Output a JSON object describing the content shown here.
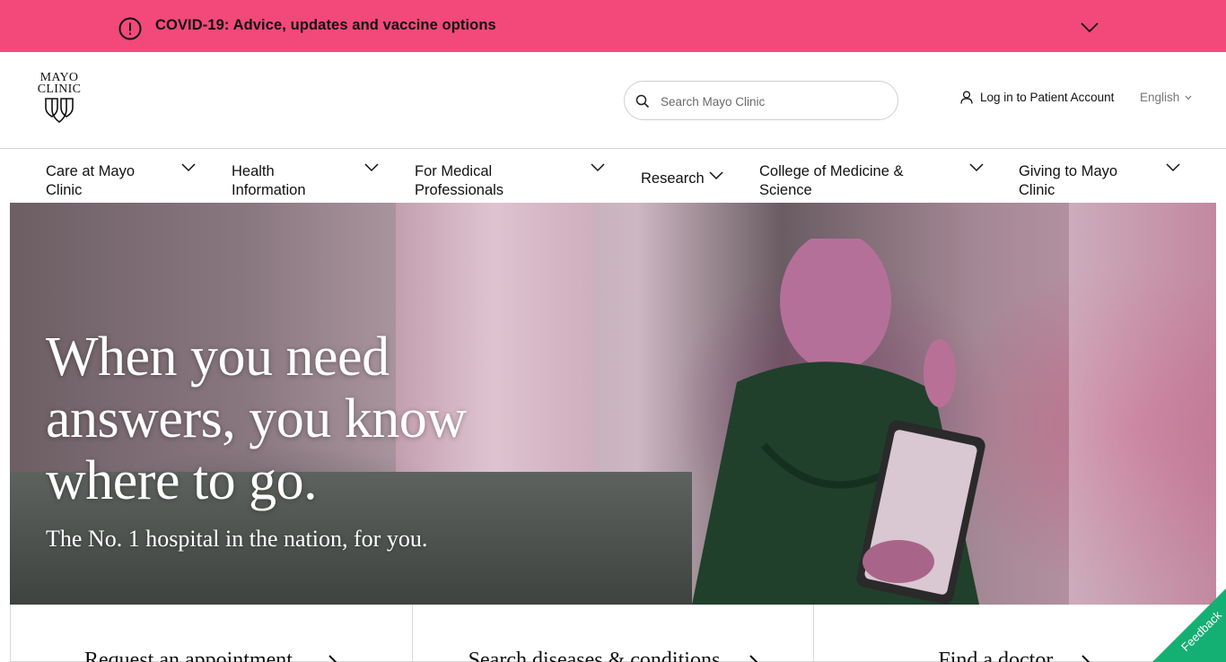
{
  "covid_banner": {
    "text": "COVID-19: Advice, updates and vaccine options",
    "background": "#f2497a"
  },
  "header": {
    "logo_line1": "MAYO",
    "logo_line2": "CLINIC",
    "search_placeholder": "Search Mayo Clinic",
    "login_label": "Log in to Patient Account",
    "language": "English"
  },
  "nav": {
    "items": [
      {
        "label": "Care at Mayo Clinic"
      },
      {
        "label": "Health Information"
      },
      {
        "label": "For Medical Professionals"
      },
      {
        "label": "Research"
      },
      {
        "label": "College of Medicine & Science"
      },
      {
        "label": "Giving to Mayo Clinic"
      }
    ]
  },
  "hero": {
    "headline": "When you need answers, you know where to go.",
    "subheadline": "The No. 1 hospital in the nation, for you."
  },
  "cards": [
    {
      "label": "Request an appointment"
    },
    {
      "label": "Search diseases & conditions"
    },
    {
      "label": "Find a doctor"
    }
  ],
  "feedback": {
    "label": "Feedback",
    "color": "#14b073"
  }
}
